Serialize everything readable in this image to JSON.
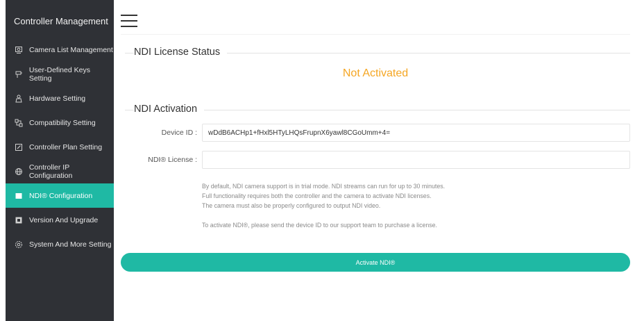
{
  "sidebar": {
    "title": "Controller Management",
    "items": [
      {
        "label": "Camera List Management",
        "icon": "camera-list-icon"
      },
      {
        "label": "User-Defined Keys Setting",
        "icon": "keys-icon"
      },
      {
        "label": "Hardware Setting",
        "icon": "hardware-icon"
      },
      {
        "label": "Compatibility Setting",
        "icon": "compatibility-icon"
      },
      {
        "label": "Controller Plan Setting",
        "icon": "edit-icon"
      },
      {
        "label": "Controller IP Configuration",
        "icon": "network-icon"
      },
      {
        "label": "NDI® Configuration",
        "icon": "ndi-icon",
        "active": true
      },
      {
        "label": "Version And Upgrade",
        "icon": "upgrade-icon"
      },
      {
        "label": "System And More Setting",
        "icon": "gear-icon"
      }
    ]
  },
  "header": {
    "menu_icon": "hamburger-menu-icon"
  },
  "license_status": {
    "title": "NDI License Status",
    "status": "Not Activated",
    "status_color": "#f5a623"
  },
  "activation": {
    "title": "NDI Activation",
    "device_id_label": "Device ID :",
    "device_id_value": "wDdB6ACHp1+fHxl5HTyLHQsFrupnX6yawl8CGoUmm+4=",
    "license_label": "NDI® License :",
    "license_value": "",
    "notes": [
      "By default, NDI camera support is in trial mode. NDI streams can run for up to 30 minutes.",
      "Full functionality requires both the controller and the camera to activate NDI licenses.",
      "The camera must also be properly configured to output NDI video.",
      "To activate NDI®, please send the device ID to our support team to purchase a license."
    ],
    "button_label": "Activate NDI®"
  },
  "colors": {
    "accent": "#1fb9a4",
    "sidebar_bg": "#2f3136",
    "warning": "#f5a623"
  }
}
